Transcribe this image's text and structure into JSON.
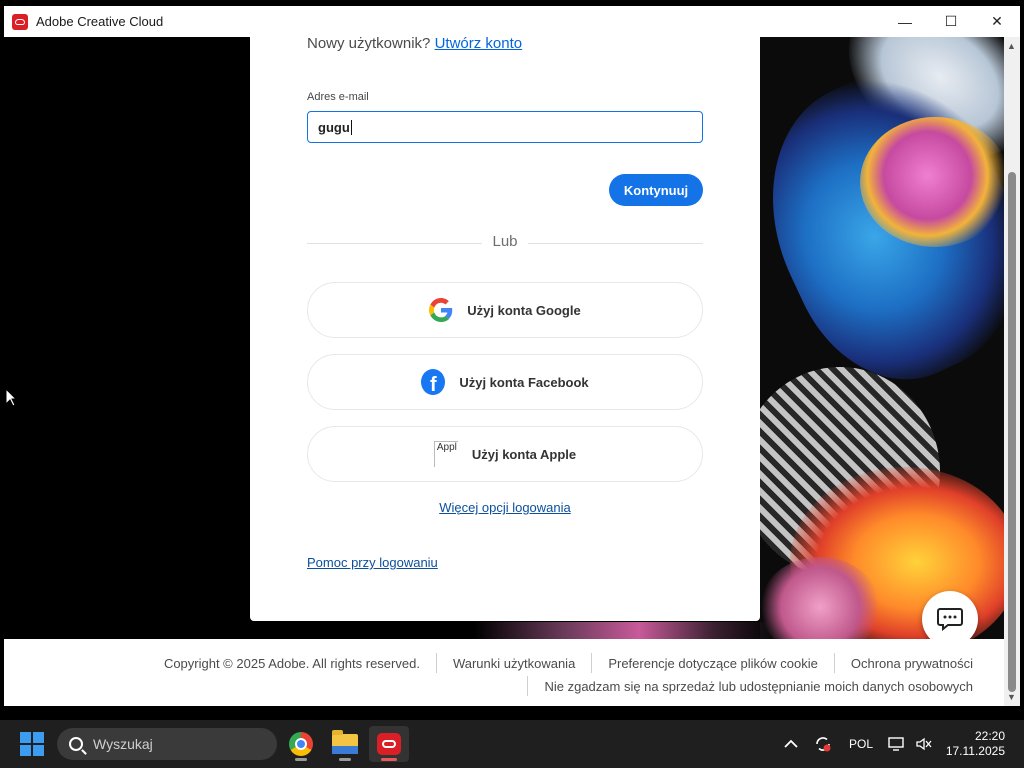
{
  "window": {
    "title": "Adobe Creative Cloud",
    "controls": {
      "minimize": "—",
      "maximize": "☐",
      "close": "✕"
    }
  },
  "login": {
    "new_user_text": "Nowy użytkownik?",
    "create_account_link": "Utwórz konto",
    "email_label": "Adres e-mail",
    "email_value": "gugu",
    "continue_button": "Kontynuuj",
    "or_text": "Lub",
    "google_button": "Użyj konta Google",
    "facebook_button": "Użyj konta Facebook",
    "apple_button": "Użyj konta Apple",
    "apple_broken_image_alt": "Appl",
    "more_options_link": "Więcej opcji logowania",
    "help_link": "Pomoc przy logowaniu"
  },
  "footer": {
    "copyright": "Copyright © 2025 Adobe. All rights reserved.",
    "terms": "Warunki użytkowania",
    "cookie_prefs": "Preferencje dotyczące plików cookie",
    "privacy": "Ochrona prywatności",
    "do_not_sell": "Nie zgadzam się na sprzedaż lub udostępnianie moich danych osobowych"
  },
  "taskbar": {
    "search_placeholder": "Wyszukaj",
    "apps": [
      "chrome-icon",
      "file-explorer-icon",
      "creative-cloud-icon"
    ],
    "tray_language": "POL",
    "time": "22:20",
    "date": "17.11.2025"
  },
  "colors": {
    "accent": "#1473e6",
    "link": "#0b4f9c",
    "adobe_red": "#da1f26",
    "facebook_blue": "#1877f2"
  }
}
